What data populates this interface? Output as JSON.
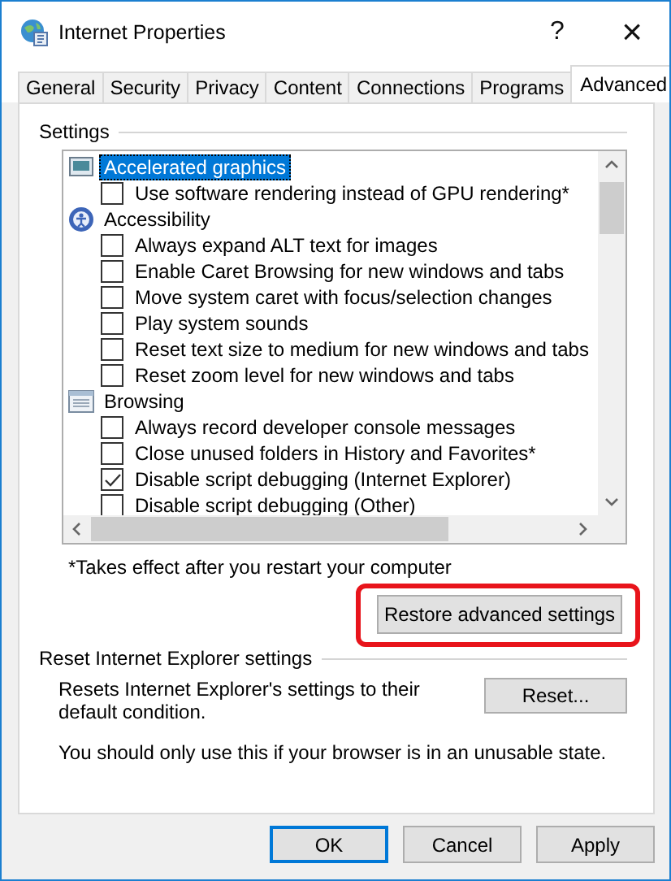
{
  "window": {
    "title": "Internet Properties",
    "help": "?",
    "close": "×"
  },
  "tabs": [
    {
      "label": "General",
      "selected": false
    },
    {
      "label": "Security",
      "selected": false
    },
    {
      "label": "Privacy",
      "selected": false
    },
    {
      "label": "Content",
      "selected": false
    },
    {
      "label": "Connections",
      "selected": false
    },
    {
      "label": "Programs",
      "selected": false
    },
    {
      "label": "Advanced",
      "selected": true
    }
  ],
  "settings": {
    "title": "Settings",
    "tree": [
      {
        "label": "Accelerated graphics",
        "selected": true,
        "children": [
          {
            "label": "Use software rendering instead of GPU rendering*",
            "checked": false
          }
        ]
      },
      {
        "label": "Accessibility",
        "selected": false,
        "children": [
          {
            "label": "Always expand ALT text for images",
            "checked": false
          },
          {
            "label": "Enable Caret Browsing for new windows and tabs",
            "checked": false
          },
          {
            "label": "Move system caret with focus/selection changes",
            "checked": false
          },
          {
            "label": "Play system sounds",
            "checked": false
          },
          {
            "label": "Reset text size to medium for new windows and tabs",
            "checked": false
          },
          {
            "label": "Reset zoom level for new windows and tabs",
            "checked": false
          }
        ]
      },
      {
        "label": "Browsing",
        "selected": false,
        "children": [
          {
            "label": "Always record developer console messages",
            "checked": false
          },
          {
            "label": "Close unused folders in History and Favorites*",
            "checked": false
          },
          {
            "label": "Disable script debugging (Internet Explorer)",
            "checked": true
          },
          {
            "label": "Disable script debugging (Other)",
            "checked": false
          }
        ]
      }
    ],
    "footnote": "*Takes effect after you restart your computer",
    "restore_button": {
      "label": "Restore advanced settings",
      "highlighted": true
    }
  },
  "reset": {
    "title": "Reset Internet Explorer settings",
    "description": "Resets Internet Explorer's settings to their default condition.",
    "button": "Reset...",
    "warning": "You should only use this if your browser is in an unusable state."
  },
  "buttons": [
    {
      "label": "OK",
      "default": true
    },
    {
      "label": "Cancel",
      "default": false
    },
    {
      "label": "Apply",
      "default": false
    }
  ]
}
